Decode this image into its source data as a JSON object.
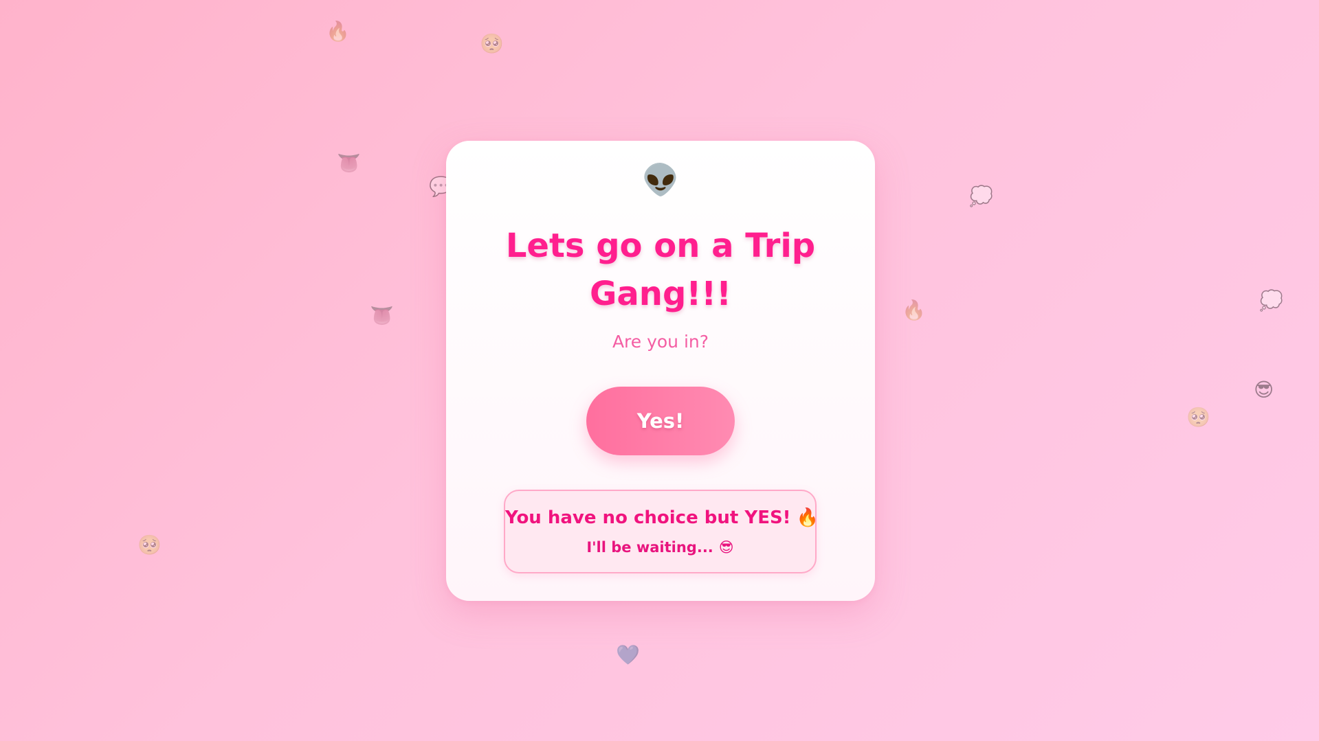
{
  "page": {
    "header_emoji": "👽",
    "title": "Lets go on a Trip Gang!!!",
    "subtitle": "Are you in?",
    "yes_button_label": "Yes!",
    "notice": {
      "line1_text": "You have no choice but YES!",
      "line1_emoji": "🔥",
      "line2_text": "I'll be waiting...",
      "line2_emoji": "😎"
    }
  },
  "background_emojis": {
    "e1": "🔥",
    "e2": "🥺",
    "e3": "👅",
    "e4": "💬",
    "e5": "👅",
    "e6": "💭",
    "e7": "🔥",
    "e8": "💭",
    "e9": "😎",
    "e10": "🥺",
    "e11": "🥺",
    "e12": "💙"
  },
  "colors": {
    "title": "#ff1f8e",
    "subtitle": "#f45da3",
    "button_start": "#ff6f9e",
    "button_end": "#ff8bb2",
    "notice_bg": "#ffe8f1",
    "notice_border": "#ffa9c8",
    "background": "#ffc2dc"
  }
}
